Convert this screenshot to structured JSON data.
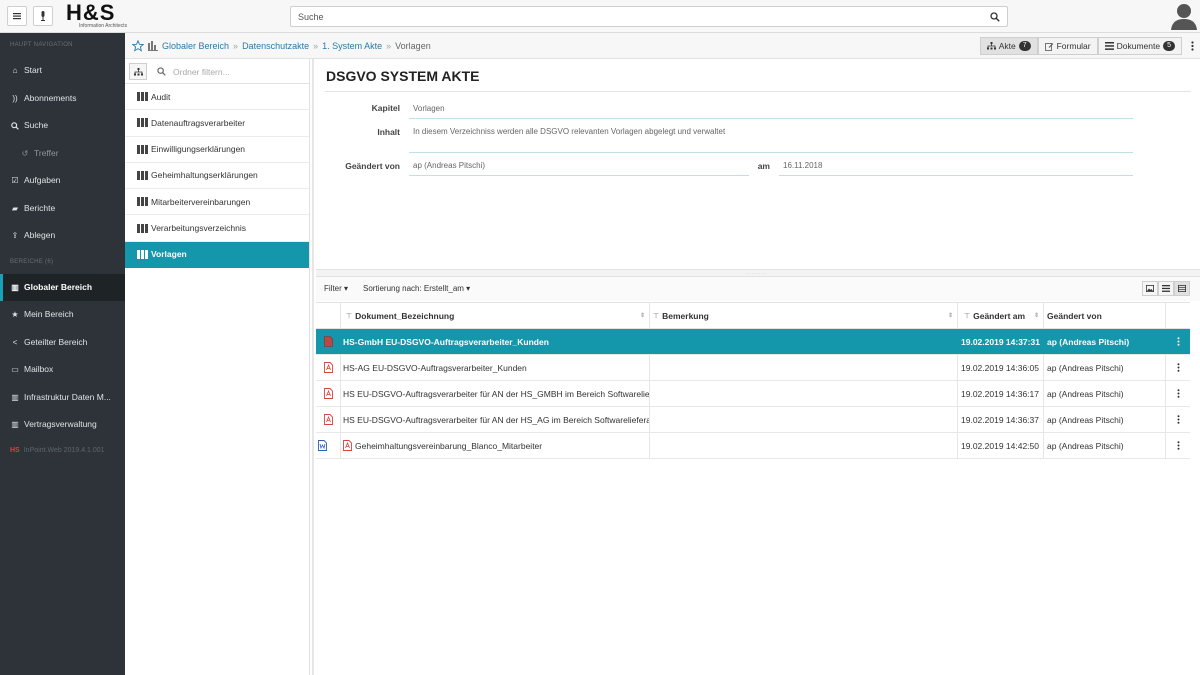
{
  "topbar": {
    "menu_icon": "hamburger-icon",
    "mic_icon": "microphone-icon",
    "logo_text": "H&S",
    "logo_subtext": "Information Architects",
    "search_placeholder": "Suche",
    "search_icon": "search-icon",
    "user_icon": "user-avatar-icon"
  },
  "sidebar": {
    "section_nav": "HAUPT NAVIGATION",
    "nav_items": [
      {
        "label": "Start",
        "icon": "home-icon"
      },
      {
        "label": "Abonnements",
        "icon": "rss-icon"
      },
      {
        "label": "Suche",
        "icon": "search-icon"
      },
      {
        "label": "Treffer",
        "icon": "history-icon"
      },
      {
        "label": "Aufgaben",
        "icon": "checkbox-icon"
      },
      {
        "label": "Berichte",
        "icon": "book-icon"
      },
      {
        "label": "Ablegen",
        "icon": "upload-icon"
      }
    ],
    "section_areas": "BEREICHE (6)",
    "area_items": [
      {
        "label": "Globaler Bereich",
        "icon": "area-icon"
      },
      {
        "label": "Mein Bereich",
        "icon": "star-icon"
      },
      {
        "label": "Geteilter Bereich",
        "icon": "share-icon"
      },
      {
        "label": "Mailbox",
        "icon": "inbox-icon"
      },
      {
        "label": "Infrastruktur Daten M...",
        "icon": "area-icon"
      },
      {
        "label": "Vertragsverwaltung",
        "icon": "area-icon"
      }
    ],
    "version_prefix": "HS",
    "version": "InPoint.Web 2019.4.1.001"
  },
  "breadcrumb": {
    "items": [
      "Globaler Bereich",
      "Datenschutzakte",
      "1. System Akte"
    ],
    "current": "Vorlagen",
    "separator": "»"
  },
  "toolbar": {
    "akte_label": "Akte",
    "akte_count": "7",
    "formular_label": "Formular",
    "dokumente_label": "Dokumente",
    "dokumente_count": "5"
  },
  "tree": {
    "filter_placeholder": "Ordner filtern...",
    "items": [
      "Audit",
      "Datenauftragsverarbeiter",
      "Einwilligungserklärungen",
      "Geheimhaltungserklärungen",
      "Mitarbeitervereinbarungen",
      "Verarbeitungsverzeichnis",
      "Vorlagen"
    ],
    "selected": "Vorlagen"
  },
  "form": {
    "title": "DSGVO SYSTEM AKTE",
    "kapitel_label": "Kapitel",
    "kapitel_value": "Vorlagen",
    "inhalt_label": "Inhalt",
    "inhalt_value": "In diesem Verzeichniss werden alle DSGVO relevanten Vorlagen abgelegt und verwaltet",
    "geaendert_von_label": "Geändert von",
    "geaendert_von_value": "ap (Andreas Pitschi)",
    "am_label": "am",
    "am_value": "16.11.2018"
  },
  "list": {
    "filter_label": "Filter",
    "sort_label": "Sortierung nach: Erstellt_am",
    "columns": [
      "Dokument_Bezeichnung",
      "Bemerkung",
      "Geändert am",
      "Geändert von"
    ],
    "rows": [
      {
        "name": "HS-GmbH EU-DSGVO-Auftragsverarbeiter_Kunden",
        "remark": "",
        "changed_at": "19.02.2019 14:37:31",
        "changed_by": "ap (Andreas Pitschi)"
      },
      {
        "name": "HS-AG EU-DSGVO-Auftragsverarbeiter_Kunden",
        "remark": "",
        "changed_at": "19.02.2019 14:36:05",
        "changed_by": "ap (Andreas Pitschi)"
      },
      {
        "name": "HS EU-DSGVO-Auftragsverarbeiter für AN der HS_GMBH im Bereich Softwarelief...",
        "remark": "",
        "changed_at": "19.02.2019 14:36:17",
        "changed_by": "ap (Andreas Pitschi)"
      },
      {
        "name": "HS EU-DSGVO-Auftragsverarbeiter für AN der HS_AG im Bereich Softwarelieferant",
        "remark": "",
        "changed_at": "19.02.2019 14:36:37",
        "changed_by": "ap (Andreas Pitschi)"
      },
      {
        "name": "Geheimhaltungsvereinbarung_Blanco_Mitarbeiter",
        "remark": "",
        "changed_at": "19.02.2019 14:42:50",
        "changed_by": "ap (Andreas Pitschi)"
      }
    ],
    "selected_row": 0
  },
  "colors": {
    "accent": "#1496ab",
    "sidebar_bg": "#2d3338",
    "pdf_red": "#d8443c"
  }
}
